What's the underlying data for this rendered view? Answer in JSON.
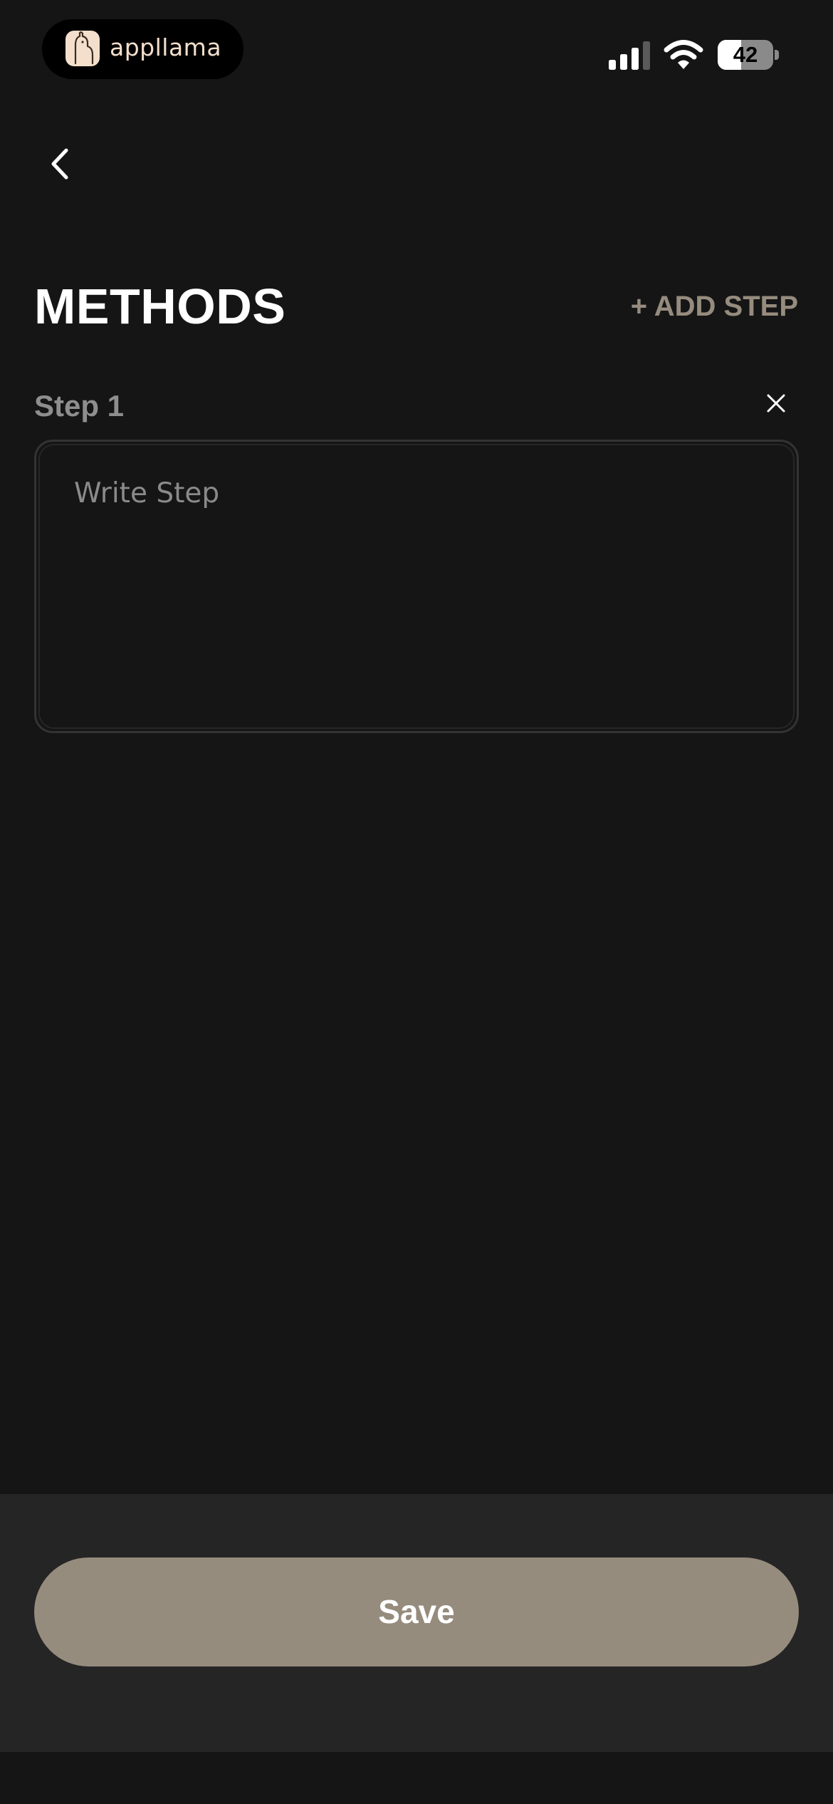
{
  "status_bar": {
    "app_name": "appllama",
    "battery_level": "42",
    "battery_fraction": 0.42,
    "icons": [
      "llama-logo-icon",
      "cellular-signal-icon",
      "wifi-icon",
      "battery-icon"
    ]
  },
  "nav": {
    "back_icon": "chevron-left-icon"
  },
  "header": {
    "title": "METHODS",
    "add_step_label": "+ ADD STEP"
  },
  "steps": [
    {
      "label": "Step 1",
      "value": "",
      "placeholder": "Write Step",
      "remove_icon": "close-icon"
    }
  ],
  "footer": {
    "save_label": "Save"
  },
  "colors": {
    "background": "#151515",
    "accent": "#968c7e",
    "footer_background": "#252525",
    "muted_text": "#8e8e8e",
    "logo_tint": "#f3dfcc"
  }
}
